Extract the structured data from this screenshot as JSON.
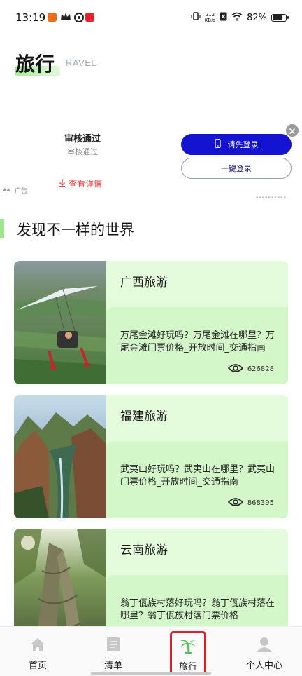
{
  "status_bar": {
    "time": "13:19",
    "net_speed_value": "212",
    "net_speed_unit": "KB/s",
    "battery_percent": "82%",
    "battery_level": 0.82
  },
  "header": {
    "title": "旅行",
    "subtitle": "RAVEL"
  },
  "ad": {
    "title": "审核通过",
    "subtitle": "审核通过",
    "detail_link": "查看详情",
    "ad_label": "广告",
    "login_button": "请先登录",
    "onekey_button": "一键登录"
  },
  "section": {
    "title": "发现不一样的世界"
  },
  "cards": [
    {
      "title": "广西旅游",
      "description": "万尾金滩好玩吗？万尾金滩在哪里？万尾金滩门票价格_开放时间_交通指南",
      "views": "626828"
    },
    {
      "title": "福建旅游",
      "description": "武夷山好玩吗？武夷山在哪里？武夷山门票价格_开放时间_交通指南",
      "views": "868395"
    },
    {
      "title": "云南旅游",
      "description": "翁丁佤族村落好玩吗？翁丁佤族村落在哪里？翁丁佤族村落门票价格",
      "views": ""
    }
  ],
  "nav": {
    "items": [
      {
        "label": "首页",
        "icon": "home-icon"
      },
      {
        "label": "清单",
        "icon": "list-icon"
      },
      {
        "label": "旅行",
        "icon": "palm-tree-icon",
        "active": true
      },
      {
        "label": "个人中心",
        "icon": "person-icon"
      }
    ]
  },
  "colors": {
    "accent_green": "#a6ec9a",
    "card_bg": "#e4fbdc",
    "login_blue": "#1313d1",
    "active_outline": "#d8222a"
  }
}
